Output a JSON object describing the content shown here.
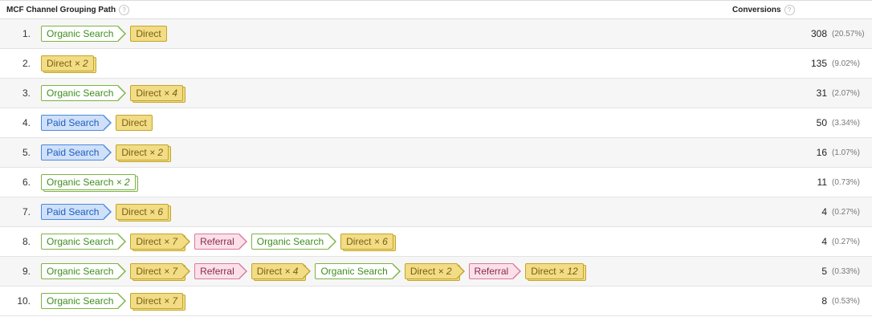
{
  "header": {
    "path_label": "MCF Channel Grouping Path",
    "conv_label": "Conversions",
    "help_glyph": "?"
  },
  "rows": [
    {
      "num": "1.",
      "conversions": "308",
      "pct": "(20.57%)",
      "path": [
        {
          "type": "organic",
          "label": "Organic Search",
          "mult": ""
        },
        {
          "type": "direct",
          "label": "Direct",
          "mult": ""
        }
      ]
    },
    {
      "num": "2.",
      "conversions": "135",
      "pct": "(9.02%)",
      "path": [
        {
          "type": "direct",
          "label": "Direct",
          "mult": "× 2"
        }
      ]
    },
    {
      "num": "3.",
      "conversions": "31",
      "pct": "(2.07%)",
      "path": [
        {
          "type": "organic",
          "label": "Organic Search",
          "mult": ""
        },
        {
          "type": "direct",
          "label": "Direct",
          "mult": "× 4"
        }
      ]
    },
    {
      "num": "4.",
      "conversions": "50",
      "pct": "(3.34%)",
      "path": [
        {
          "type": "paid",
          "label": "Paid Search",
          "mult": ""
        },
        {
          "type": "direct",
          "label": "Direct",
          "mult": ""
        }
      ]
    },
    {
      "num": "5.",
      "conversions": "16",
      "pct": "(1.07%)",
      "path": [
        {
          "type": "paid",
          "label": "Paid Search",
          "mult": ""
        },
        {
          "type": "direct",
          "label": "Direct",
          "mult": "× 2"
        }
      ]
    },
    {
      "num": "6.",
      "conversions": "11",
      "pct": "(0.73%)",
      "path": [
        {
          "type": "organic",
          "label": "Organic Search",
          "mult": "× 2"
        }
      ]
    },
    {
      "num": "7.",
      "conversions": "4",
      "pct": "(0.27%)",
      "path": [
        {
          "type": "paid",
          "label": "Paid Search",
          "mult": ""
        },
        {
          "type": "direct",
          "label": "Direct",
          "mult": "× 6"
        }
      ]
    },
    {
      "num": "8.",
      "conversions": "4",
      "pct": "(0.27%)",
      "path": [
        {
          "type": "organic",
          "label": "Organic Search",
          "mult": ""
        },
        {
          "type": "direct",
          "label": "Direct",
          "mult": "× 7"
        },
        {
          "type": "referral",
          "label": "Referral",
          "mult": ""
        },
        {
          "type": "organic",
          "label": "Organic Search",
          "mult": ""
        },
        {
          "type": "direct",
          "label": "Direct",
          "mult": "× 6"
        }
      ]
    },
    {
      "num": "9.",
      "conversions": "5",
      "pct": "(0.33%)",
      "path": [
        {
          "type": "organic",
          "label": "Organic Search",
          "mult": ""
        },
        {
          "type": "direct",
          "label": "Direct",
          "mult": "× 7"
        },
        {
          "type": "referral",
          "label": "Referral",
          "mult": ""
        },
        {
          "type": "direct",
          "label": "Direct",
          "mult": "× 4"
        },
        {
          "type": "organic",
          "label": "Organic Search",
          "mult": ""
        },
        {
          "type": "direct",
          "label": "Direct",
          "mult": "× 2"
        },
        {
          "type": "referral",
          "label": "Referral",
          "mult": ""
        },
        {
          "type": "direct",
          "label": "Direct",
          "mult": "× 12"
        }
      ]
    },
    {
      "num": "10.",
      "conversions": "8",
      "pct": "(0.53%)",
      "path": [
        {
          "type": "organic",
          "label": "Organic Search",
          "mult": ""
        },
        {
          "type": "direct",
          "label": "Direct",
          "mult": "× 7"
        }
      ]
    }
  ]
}
